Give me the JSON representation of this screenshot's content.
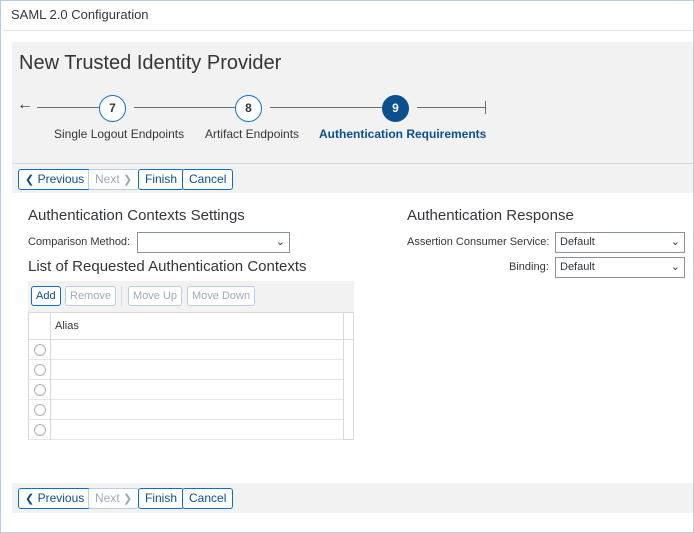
{
  "window": {
    "title": "SAML 2.0 Configuration"
  },
  "page": {
    "title": "New Trusted Identity Provider"
  },
  "wizard": {
    "steps": [
      {
        "number": "7",
        "label": "Single Logout Endpoints",
        "active": false
      },
      {
        "number": "8",
        "label": "Artifact Endpoints",
        "active": false
      },
      {
        "number": "9",
        "label": "Authentication Requirements",
        "active": true
      }
    ]
  },
  "nav_buttons": {
    "previous": "Previous",
    "next": "Next",
    "finish": "Finish",
    "cancel": "Cancel"
  },
  "auth_contexts": {
    "title": "Authentication Contexts Settings",
    "comparison_label": "Comparison Method:",
    "comparison_value": ""
  },
  "requested_contexts": {
    "title": "List of Requested Authentication Contexts",
    "buttons": {
      "add": "Add",
      "remove": "Remove",
      "move_up": "Move Up",
      "move_down": "Move Down"
    },
    "column": "Alias",
    "rows": [
      "",
      "",
      "",
      "",
      ""
    ]
  },
  "auth_response": {
    "title": "Authentication Response",
    "acs_label": "Assertion Consumer Service:",
    "acs_value": "Default",
    "binding_label": "Binding:",
    "binding_value": "Default"
  },
  "colors": {
    "accent": "#0a6ed1",
    "active_step": "#0a4f8e",
    "toolbar_bg": "#f2f2f2"
  }
}
